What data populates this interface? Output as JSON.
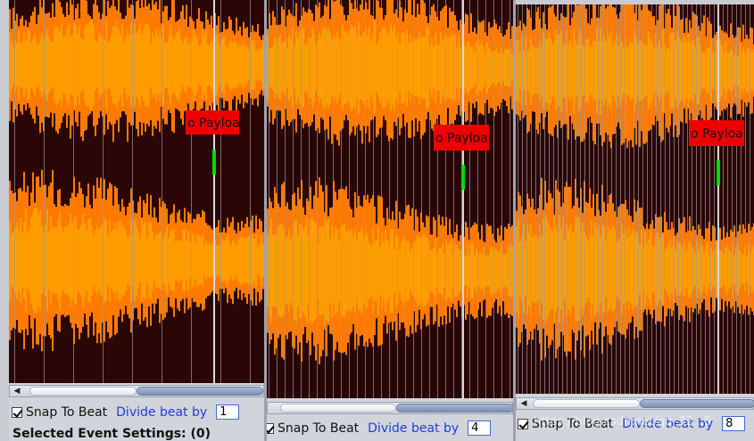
{
  "panels": [
    {
      "event_label": "o Payloa",
      "snap_label": "Snap To Beat",
      "snap_checked": true,
      "divide_label": "Divide beat by",
      "divide_value": "1"
    },
    {
      "event_label": "o Payloa",
      "snap_label": "Snap To Beat",
      "snap_checked": true,
      "divide_label": "Divide beat by",
      "divide_value": "4"
    },
    {
      "event_label": "o Payloa",
      "snap_label": "Snap To Beat",
      "snap_checked": true,
      "divide_label": "Divide beat by",
      "divide_value": "8"
    }
  ],
  "selected_event_settings": "Selected Event Settings: (0)",
  "watermark": "https://blog.csdn.net/qq_32...5",
  "colors": {
    "wave_dark_orange": "#ff7a00",
    "wave_light_orange": "#ff9d00",
    "wave_background": "#2a0606",
    "beat_line": "#9a9aa0",
    "event_box": "#ee0000",
    "event_marker": "#00dd00"
  }
}
